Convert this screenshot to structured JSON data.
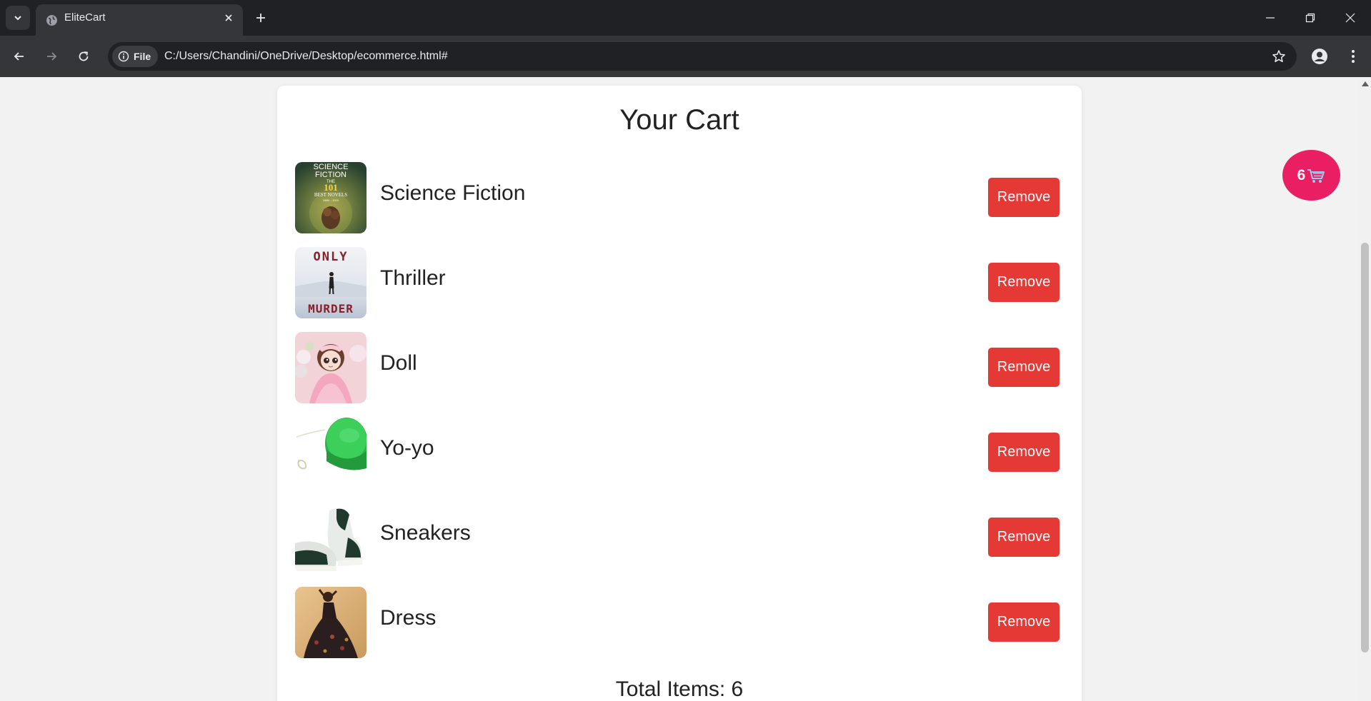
{
  "browser": {
    "tab_title": "EliteCart",
    "site_chip": "File",
    "url": "C:/Users/Chandini/OneDrive/Desktop/ecommerce.html#"
  },
  "cart": {
    "title": "Your Cart",
    "items": [
      {
        "name": "Science Fiction",
        "remove_label": "Remove",
        "image": "science-fiction-book-cover"
      },
      {
        "name": "Thriller",
        "remove_label": "Remove",
        "image": "thriller-book-cover"
      },
      {
        "name": "Doll",
        "remove_label": "Remove",
        "image": "doll-photo"
      },
      {
        "name": "Yo-yo",
        "remove_label": "Remove",
        "image": "yoyo-photo"
      },
      {
        "name": "Sneakers",
        "remove_label": "Remove",
        "image": "sneakers-photo"
      },
      {
        "name": "Dress",
        "remove_label": "Remove",
        "image": "dress-photo"
      }
    ],
    "total_label": "Total Items: 6",
    "cart_count": "6"
  },
  "book_covers": {
    "science_fiction_lines": [
      "SCIENCE",
      "FICTION",
      "THE",
      "101",
      "BEST NOVELS",
      "1985 – 2010"
    ],
    "thriller_lines": [
      "ONLY",
      "MURDER"
    ]
  },
  "colors": {
    "remove_button": "#e53935",
    "cart_fab": "#e91e63",
    "chrome_dark": "#202124",
    "chrome_toolbar": "#35363a"
  }
}
